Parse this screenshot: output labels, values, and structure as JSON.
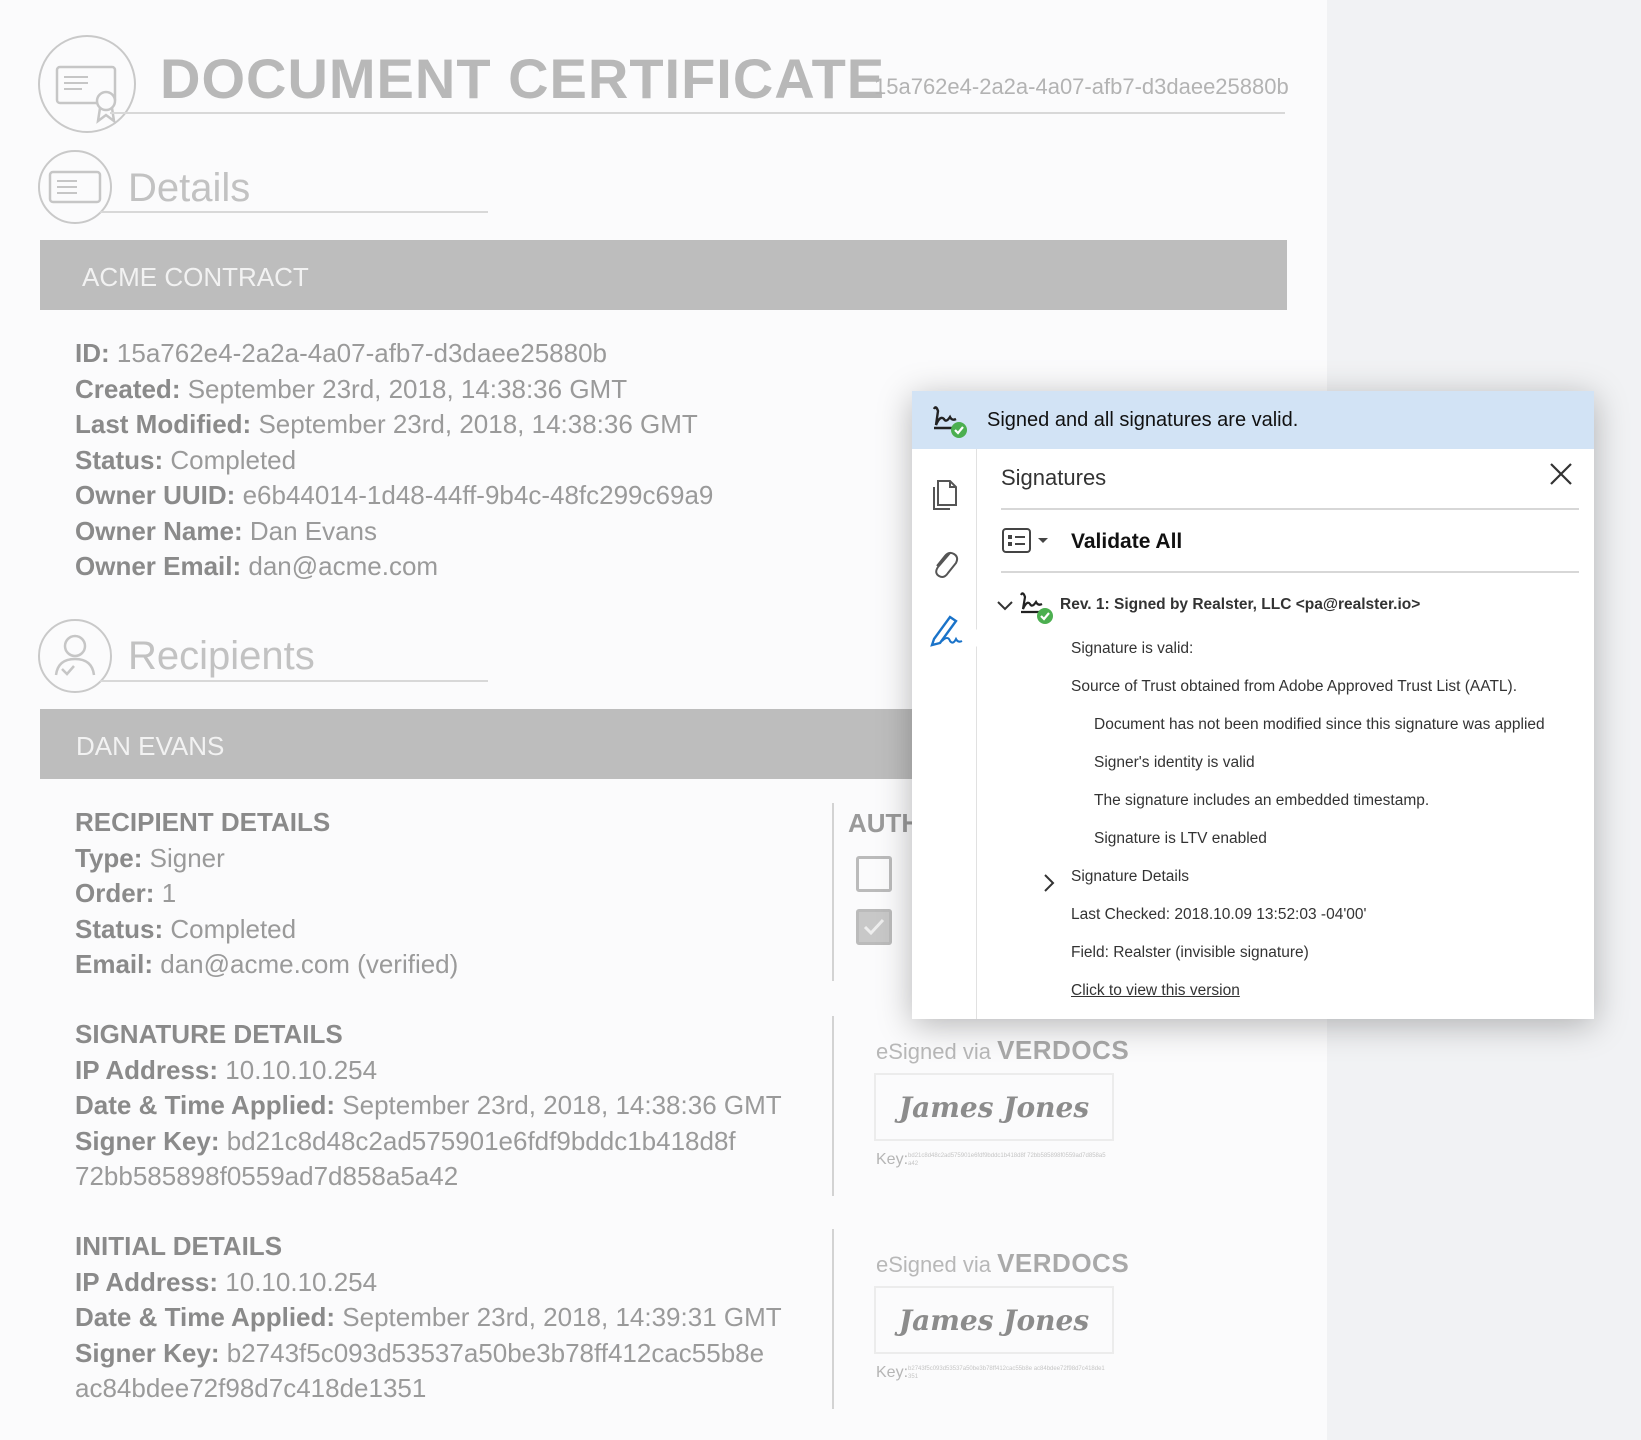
{
  "certificate": {
    "title": "DOCUMENT CERTIFICATE",
    "id": "15a762e4-2a2a-4a07-afb7-d3daee25880b"
  },
  "details": {
    "section_title": "Details",
    "bar_label": "ACME CONTRACT",
    "fields": [
      {
        "label": "ID:",
        "value": " 15a762e4-2a2a-4a07-afb7-d3daee25880b"
      },
      {
        "label": "Created:",
        "value": " September 23rd, 2018, 14:38:36 GMT"
      },
      {
        "label": "Last Modified:",
        "value": " September 23rd, 2018, 14:38:36 GMT"
      },
      {
        "label": "Status:",
        "value": " Completed"
      },
      {
        "label": "Owner UUID:",
        "value": " e6b44014-1d48-44ff-9b4c-48fc299c69a9"
      },
      {
        "label": "Owner Name:",
        "value": " Dan Evans"
      },
      {
        "label": "Owner Email:",
        "value": " dan@acme.com"
      }
    ]
  },
  "recipients": {
    "section_title": "Recipients",
    "bar_label": "DAN EVANS",
    "auth_heading": "AUTH",
    "recipient_details": {
      "heading": "RECIPIENT DETAILS",
      "fields": [
        {
          "label": "Type:",
          "value": " Signer"
        },
        {
          "label": "Order:",
          "value": " 1"
        },
        {
          "label": "Status:",
          "value": " Completed"
        },
        {
          "label": "Email:",
          "value": " dan@acme.com (verified)"
        }
      ]
    },
    "signature_details": {
      "heading": "SIGNATURE DETAILS",
      "fields": [
        {
          "label": "IP Address:",
          "value": " 10.10.10.254"
        },
        {
          "label": "Date & Time Applied:",
          "value": " September 23rd, 2018, 14:38:36 GMT"
        },
        {
          "label": "Signer Key:",
          "value": " bd21c8d48c2ad575901e6fdf9bddc1b418d8f"
        }
      ],
      "key_continued": "72bb585898f0559ad7d858a5a42"
    },
    "initial_details": {
      "heading": "INITIAL DETAILS",
      "fields": [
        {
          "label": "IP Address:",
          "value": " 10.10.10.254"
        },
        {
          "label": "Date & Time Applied:",
          "value": " September 23rd, 2018, 14:39:31 GMT"
        },
        {
          "label": "Signer Key:",
          "value": " b2743f5c093d53537a50be3b78ff412cac55b8e"
        }
      ],
      "key_continued": "ac84bdee72f98d7c418de1351"
    },
    "esign": [
      {
        "via": "eSigned via ",
        "brand": "VERDOCS",
        "signature": "James Jones",
        "key_label": "Key:",
        "key_small": "bd21c8d48c2ad575901e6fdf9bddc1b418d8f 72bb585898f0559ad7d858a5a42"
      },
      {
        "via": "eSigned via ",
        "brand": "VERDOCS",
        "signature": "James Jones",
        "key_label": "Key:",
        "key_small": "b2743f5c093d53537a50be3b78ff412cac55b8e ac84bdee72f98d7c418de1351"
      }
    ]
  },
  "signature_panel": {
    "banner": "Signed and all signatures are valid.",
    "title": "Signatures",
    "validate_all": "Validate All",
    "revision": "Rev. 1: Signed by Realster, LLC <pa@realster.io>",
    "lines": {
      "valid": "Signature is valid:",
      "trust": "Source of Trust obtained from Adobe Approved Trust List (AATL).",
      "not_modified": "Document has not been modified since this signature was applied",
      "identity": "Signer's identity is valid",
      "timestamp": "The signature includes an embedded timestamp.",
      "ltv": "Signature is LTV enabled",
      "details": "Signature Details",
      "last_checked": "Last Checked: 2018.10.09 13:52:03 -04'00'",
      "field": "Field: Realster (invisible signature)",
      "view_link": "Click to view this version"
    },
    "colors": {
      "banner_bg": "#d2e3f5",
      "valid_green": "#4caf50",
      "accent_blue": "#1a73c9"
    }
  }
}
